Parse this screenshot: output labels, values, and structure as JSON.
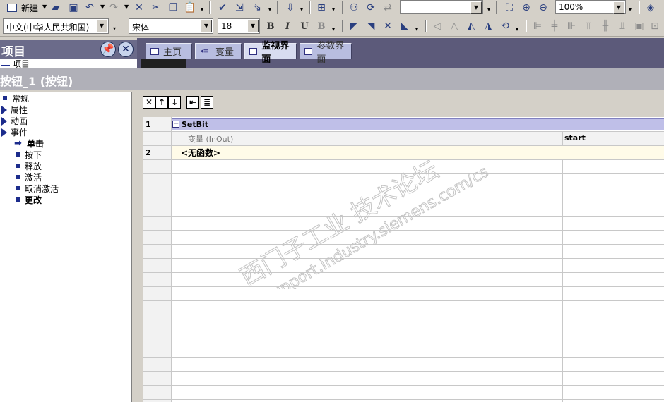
{
  "toolbar": {
    "new_label": "新建",
    "zoom_value": "100%",
    "language_value": "中文(中华人民共和国)",
    "font_value": "宋体",
    "size_value": "18",
    "bold_label": "B",
    "italic_label": "I",
    "underline_label": "U",
    "strike_label": "B"
  },
  "project": {
    "title": "项目",
    "sub_item": "项目"
  },
  "tabs": [
    {
      "label": "主页"
    },
    {
      "label": "变量"
    },
    {
      "label": "监视界面"
    },
    {
      "label": "参数界面"
    }
  ],
  "properties": {
    "title": "按钮_1 (按钮)"
  },
  "tree": {
    "general": "常规",
    "attributes": "属性",
    "animation": "动画",
    "events": "事件",
    "click": "单击",
    "press": "按下",
    "release": "释放",
    "activate": "激活",
    "deactivate": "取消激活",
    "change": "更改"
  },
  "grid": {
    "row1_num": "1",
    "function_name": "SetBit",
    "param_label": "变量 (InOut)",
    "param_value": "start",
    "row2_num": "2",
    "no_function": "<无函数>"
  },
  "watermark": {
    "line1": "西门子工业 技术论坛",
    "line2": "support.industry.siemens.com/cs"
  }
}
